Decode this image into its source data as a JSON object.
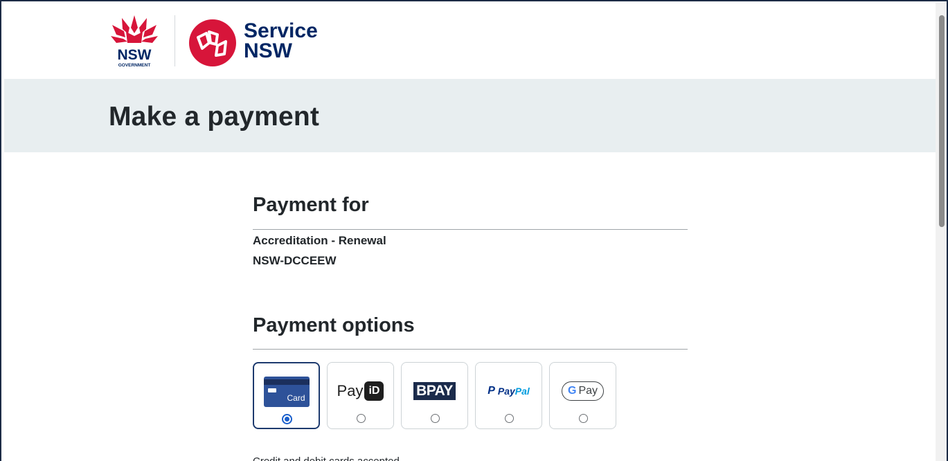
{
  "header": {
    "nsw_logo_text": "NSW",
    "nsw_logo_sub": "GOVERNMENT",
    "service_line1": "Service",
    "service_line2": "NSW"
  },
  "banner": {
    "title": "Make a payment"
  },
  "payment_for": {
    "heading": "Payment for",
    "item": "Accreditation - Renewal",
    "agency": "NSW-DCCEEW"
  },
  "payment_options": {
    "heading": "Payment options",
    "options": [
      {
        "label": "Card",
        "selected": true
      },
      {
        "label_pay": "Pay",
        "label_id": "iD",
        "selected": false
      },
      {
        "label": "BPAY",
        "selected": false
      },
      {
        "label_p": "P",
        "label_w1": "Pay",
        "label_w2": "Pal",
        "selected": false
      },
      {
        "label_g": "G",
        "label_pay": "Pay",
        "selected": false
      }
    ],
    "note": "Credit and debit cards accepted"
  },
  "colors": {
    "brand_navy": "#002664",
    "brand_red": "#d7153a",
    "banner_bg": "#e8eef0",
    "selected_border": "#1d3a6e",
    "radio_blue": "#1a5fcc"
  }
}
